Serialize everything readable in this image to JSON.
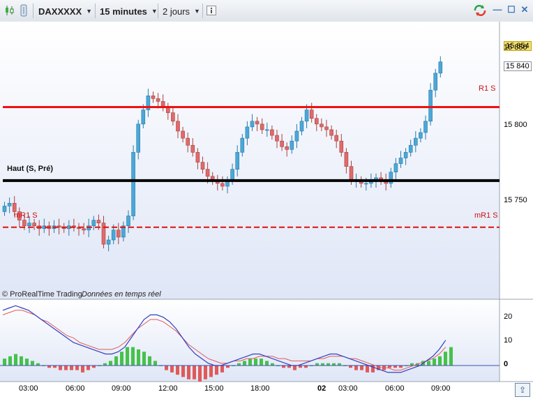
{
  "toolbar": {
    "symbol": "DAXXXXX",
    "timeframe": "15 minutes",
    "period": "2 jours",
    "info_icon": "info-icon",
    "refresh_icon": "refresh-icon"
  },
  "price_panel": {
    "price_labels": [
      "15 850",
      "15 800",
      "15 750"
    ],
    "last_price": "15 854",
    "second_price": "15 840",
    "r1_label": "R1 S",
    "mr1_label": "mR1 S",
    "mr1_left_label": "mR1 S",
    "haut_label": "Haut (S, Pré)",
    "copyright": "© ProRealTime Trading",
    "realtime": "Données en temps réel",
    "colors": {
      "up": "#4aa8d8",
      "down": "#e06a6a",
      "r1": "#ee1111",
      "haut": "#000000",
      "mr1": "#dd1111"
    }
  },
  "indicator_panel": {
    "labels": [
      "20",
      "10",
      "0"
    ]
  },
  "time_axis": {
    "labels": [
      "03:00",
      "06:00",
      "09:00",
      "12:00",
      "15:00",
      "18:00",
      "02",
      "03:00",
      "06:00",
      "09:00"
    ]
  },
  "chart_data": {
    "type": "candlestick",
    "price_levels": {
      "r1": 15822,
      "haut": 15770,
      "mr1": 15737
    },
    "ylim": [
      15690,
      15880
    ],
    "x_closes": [
      15752,
      15754,
      15748,
      15742,
      15738,
      15740,
      15738,
      15736,
      15738,
      15736,
      15738,
      15737,
      15736,
      15738,
      15737,
      15736,
      15735,
      15738,
      15742,
      15740,
      15725,
      15728,
      15735,
      15730,
      15738,
      15745,
      15790,
      15810,
      15820,
      15830,
      15828,
      15826,
      15822,
      15818,
      15812,
      15805,
      15800,
      15795,
      15790,
      15783,
      15778,
      15773,
      15770,
      15768,
      15766,
      15770,
      15778,
      15790,
      15800,
      15808,
      15812,
      15810,
      15806,
      15806,
      15802,
      15798,
      15794,
      15792,
      15798,
      15805,
      15812,
      15820,
      15814,
      15810,
      15808,
      15806,
      15802,
      15798,
      15790,
      15780,
      15770,
      15770,
      15768,
      15768,
      15770,
      15772,
      15770,
      15768,
      15776,
      15782,
      15786,
      15790,
      15795,
      15800,
      15804,
      15812,
      15834,
      15846,
      15854
    ],
    "macd": [
      3,
      4,
      5,
      4,
      3,
      2,
      1,
      0,
      -1,
      -1,
      -2,
      -2,
      -2,
      -2,
      -3,
      -2,
      -1,
      0,
      1,
      2,
      4,
      6,
      8,
      8,
      7,
      6,
      4,
      2,
      0,
      -2,
      -3,
      -4,
      -5,
      -6,
      -6,
      -7,
      -6,
      -5,
      -4,
      -3,
      -1,
      0,
      1,
      2,
      3,
      3,
      3,
      2,
      1,
      0,
      -1,
      -1,
      -2,
      -1,
      -1,
      0,
      1,
      1,
      1,
      1,
      1,
      0,
      -1,
      -2,
      -2,
      -3,
      -3,
      -2,
      -2,
      -1,
      -1,
      -1,
      0,
      1,
      1,
      2,
      2,
      3,
      4,
      6,
      8
    ],
    "line_blue": [
      24,
      25,
      26,
      25,
      24,
      22,
      20,
      18,
      16,
      14,
      12,
      10,
      9,
      8,
      7,
      6,
      5,
      5,
      6,
      8,
      12,
      16,
      20,
      22,
      22,
      21,
      19,
      16,
      12,
      8,
      5,
      3,
      1,
      0,
      0,
      1,
      2,
      3,
      4,
      5,
      5,
      4,
      3,
      2,
      1,
      0,
      0,
      1,
      2,
      3,
      4,
      5,
      5,
      4,
      3,
      2,
      1,
      0,
      -1,
      -2,
      -3,
      -3,
      -3,
      -2,
      -1,
      0,
      2,
      4,
      7,
      11
    ],
    "line_red": [
      22,
      23,
      24,
      24,
      23,
      22,
      20,
      19,
      17,
      15,
      13,
      12,
      10,
      9,
      8,
      7,
      7,
      7,
      8,
      10,
      13,
      16,
      18,
      20,
      20,
      19,
      17,
      15,
      12,
      9,
      7,
      5,
      3,
      2,
      1,
      1,
      2,
      2,
      3,
      3,
      4,
      4,
      4,
      3,
      3,
      2,
      2,
      2,
      2,
      3,
      3,
      4,
      4,
      4,
      3,
      3,
      2,
      1,
      0,
      -1,
      -1,
      -2,
      -2,
      -1,
      0,
      1,
      2,
      3,
      5,
      8
    ]
  }
}
